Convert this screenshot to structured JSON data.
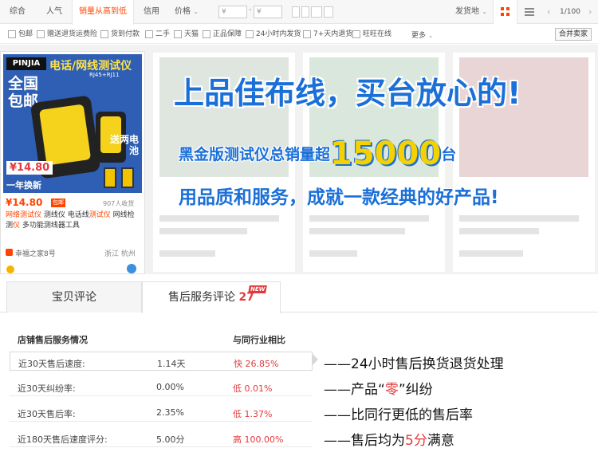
{
  "sortbar": {
    "items": [
      "综合",
      "人气",
      "销量从高到低",
      "信用",
      "价格"
    ],
    "active_index": 2,
    "price_from": "¥",
    "price_to": "¥",
    "price_dash": "-",
    "ship_from": "发货地",
    "page_text": "1/100",
    "prev_arrow": "‹",
    "next_arrow": "›",
    "chevron": "⌄"
  },
  "filters": {
    "items": [
      "包邮",
      "赠送退货运费险",
      "货到付款",
      "二手",
      "天猫",
      "正品保障",
      "24小时内发货",
      "7+天内退货",
      "旺旺在线"
    ],
    "more": "更多",
    "combine": "合并卖家"
  },
  "product": {
    "logo": "PINJIA",
    "img_title": "电话/网线测试仪",
    "img_sub": "RJ45+RJ11",
    "free_ship": "全国包邮",
    "gift": "送两电池",
    "img_price": "¥14.80",
    "warranty": "一年换新",
    "price": "¥14.80",
    "badge": "包邮",
    "sales": "907人收货",
    "title_parts": [
      {
        "text": "网络测试仪",
        "hl": true
      },
      {
        "text": " 测线仪 电话线",
        "hl": false
      },
      {
        "text": "测试仪",
        "hl": true
      },
      {
        "text": " 网线检测",
        "hl": false
      },
      {
        "text": "仪",
        "hl": true
      },
      {
        "text": " 多功能测线器工具",
        "hl": false
      }
    ],
    "shop": "幸福之家8号",
    "location": "浙江 杭州"
  },
  "banner": {
    "slogan_1": "上品佳布线，买台放心的!",
    "slogan_2_prefix": "黑金版测试仪总销量超",
    "slogan_2_number": "15000",
    "slogan_2_suffix": "台",
    "slogan_3": "用品质和服务，成就一款经典的好产品!"
  },
  "tabs": {
    "review": "宝贝评论",
    "after_sale": "售后服务评论",
    "after_sale_count": "27",
    "new_badge": "NEW"
  },
  "table": {
    "header_left": "店铺售后服务情况",
    "header_right": "与同行业相比",
    "rows": [
      {
        "label": "近30天售后速度:",
        "value": "1.14天",
        "cmp": "快 26.85%"
      },
      {
        "label": "近30天纠纷率:",
        "value": "0.00%",
        "cmp": "低 0.01%"
      },
      {
        "label": "近30天售后率:",
        "value": "2.35%",
        "cmp": "低 1.37%"
      },
      {
        "label": "近180天售后速度评分:",
        "value": "5.00分",
        "cmp": "高 100.00%"
      }
    ]
  },
  "notes": {
    "n1": "——24小时售后换货退货处理",
    "n2_prefix": "——产品“",
    "n2_red": "零",
    "n2_suffix": "”纠纷",
    "n3": "——比同行更低的售后率",
    "n4_prefix": "——售后均为",
    "n4_red": "5分",
    "n4_suffix": "满意"
  },
  "colors": {
    "accent": "#ff4400",
    "blue": "#1a6fd8",
    "yellow": "#f5d100",
    "red": "#e4393c"
  }
}
